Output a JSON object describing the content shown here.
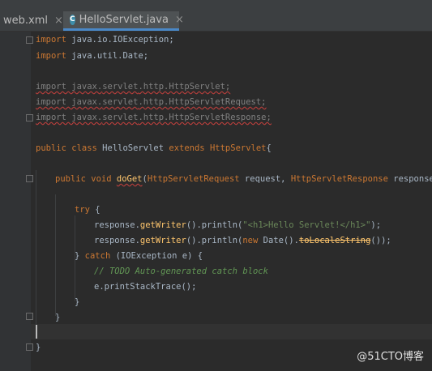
{
  "tabs": [
    {
      "label": "web.xml",
      "icon": "xml-file-icon",
      "active": false
    },
    {
      "label": "HelloServlet.java",
      "icon": "java-class-icon",
      "active": true
    }
  ],
  "code": {
    "l1": [
      "import",
      " java.io.IOException;"
    ],
    "l2": [
      "import",
      " java.util.Date;"
    ],
    "l3": [
      "import javax.",
      "servlet",
      ".http.HttpServlet;"
    ],
    "l4": [
      "import javax.",
      "servlet",
      ".http.HttpServletRequest;"
    ],
    "l5": [
      "import javax.",
      "servlet",
      ".http.HttpServletResponse;"
    ],
    "l6": [
      "public class",
      " HelloServlet ",
      "extends",
      " ",
      "HttpServlet",
      "{"
    ],
    "l7": [
      "public void",
      " ",
      "doGet",
      "(",
      "HttpServletRequest",
      " request, ",
      "HttpServletResponse",
      " response){"
    ],
    "l8": [
      "try",
      " {"
    ],
    "l9": [
      "response.",
      "getWriter",
      "().println(",
      "\"<h1>Hello Servlet!</h1>\"",
      ");"
    ],
    "l10": [
      "response.",
      "getWriter",
      "().println(",
      "new",
      " Date().",
      "toLocaleString",
      "());"
    ],
    "l11": [
      "} ",
      "catch",
      " (IOException e) {"
    ],
    "l12": "// TODO Auto-generated catch block",
    "l13": "e.printStackTrace();",
    "l14": "}",
    "l15": "}",
    "l16": "}"
  },
  "watermark": "@51CTO博客",
  "colors": {
    "keyword": "#cc7832",
    "string": "#6a8759",
    "method": "#ffc66d",
    "comment": "#629755",
    "background": "#2b2b2b"
  }
}
